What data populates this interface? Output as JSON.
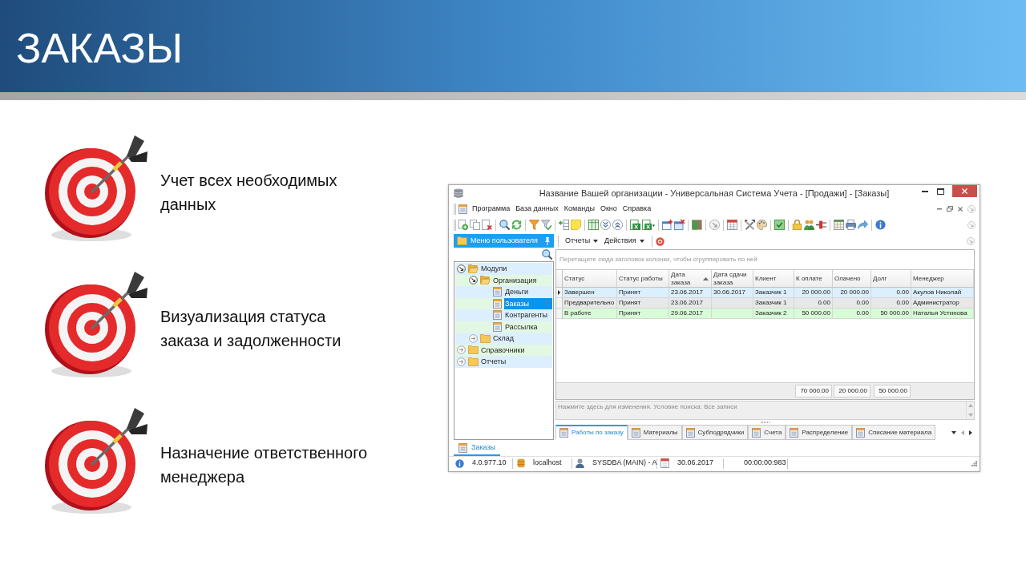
{
  "slide": {
    "title": "ЗАКАЗЫ"
  },
  "features": [
    {
      "text": "Учет всех необходимых\nданных"
    },
    {
      "text": "Визуализация статуса\nзаказа и задолженности"
    },
    {
      "text": "Назначение ответственного\nменеджера"
    }
  ],
  "window": {
    "title": "Название Вашей организации - Универсальная Система Учета - [Продажи] - [Заказы]"
  },
  "menu": [
    "Программа",
    "База данных",
    "Команды",
    "Окно",
    "Справка"
  ],
  "side_panel": {
    "title": "Меню пользователя",
    "tree": [
      {
        "label": "Модули",
        "kind": "folder",
        "expanded": true,
        "selected": false,
        "children": [
          {
            "label": "Организация",
            "kind": "folder",
            "expanded": true,
            "selected": false,
            "children": [
              {
                "label": "Деньги",
                "kind": "form",
                "selected": false
              },
              {
                "label": "Заказы",
                "kind": "form",
                "selected": true
              },
              {
                "label": "Контрагенты",
                "kind": "form",
                "selected": false
              },
              {
                "label": "Рассылка",
                "kind": "form",
                "selected": false
              }
            ]
          },
          {
            "label": "Склад",
            "kind": "folder",
            "expanded": false,
            "selected": false
          }
        ]
      },
      {
        "label": "Справочники",
        "kind": "folder",
        "expanded": false,
        "selected": false
      },
      {
        "label": "Отчеты",
        "kind": "folder",
        "expanded": false,
        "selected": false
      }
    ]
  },
  "panel_toolbar": [
    {
      "label": "Отчеты"
    },
    {
      "label": "Действия"
    }
  ],
  "grid": {
    "group_hint": "Перетащите сюда заголовок колонки, чтобы сгруппировать по ней",
    "columns": [
      {
        "label": "Статус",
        "kind": "text",
        "sorted": false
      },
      {
        "label": "Статус работы",
        "kind": "text",
        "sorted": false
      },
      {
        "label": "Дата\nзаказа",
        "kind": "text",
        "sorted": true
      },
      {
        "label": "Дата сдачи\nзаказа",
        "kind": "text",
        "sorted": false
      },
      {
        "label": "Клиент",
        "kind": "text",
        "sorted": false
      },
      {
        "label": "К оплате",
        "kind": "number",
        "sorted": false,
        "total": "70 000.00"
      },
      {
        "label": "Олачено",
        "kind": "number",
        "sorted": false,
        "total": "20 000.00"
      },
      {
        "label": "Долг",
        "kind": "number",
        "sorted": false,
        "total": "50 000.00"
      },
      {
        "label": "Менеджер",
        "kind": "text",
        "sorted": false
      }
    ],
    "rows": [
      {
        "selected": true,
        "color": "#dbeffd",
        "cells": [
          "Завершен",
          "Принят",
          "23.06.2017",
          "30.06.2017",
          "Заказчик 1",
          "20 000.00",
          "20 000.00",
          "0.00",
          "Акулов Николай"
        ]
      },
      {
        "selected": false,
        "color": "#e8e8e8",
        "cells": [
          "Предварительно",
          "Принят",
          "23.06.2017",
          null,
          "Заказчик 1",
          "0.00",
          "0.00",
          "0.00",
          "Администратор"
        ]
      },
      {
        "selected": false,
        "color": "#d8fbd8",
        "cells": [
          "В работе",
          "Принят",
          "29.06.2017",
          null,
          "Заказчик 2",
          "50 000.00",
          "0.00",
          "50 000.00",
          "Наталья Устинова"
        ]
      }
    ]
  },
  "filter_bar": {
    "text": "Нажмите здесь для изменения. Условие поиска: Все записи"
  },
  "detail_tabs": [
    {
      "label": "Работы по заказу",
      "selected": true
    },
    {
      "label": "Материалы",
      "selected": false
    },
    {
      "label": "Субподрядчики",
      "selected": false
    },
    {
      "label": "Счета",
      "selected": false
    },
    {
      "label": "Распределение",
      "selected": false
    },
    {
      "label": "Списание материала",
      "selected": false
    }
  ],
  "document_tabs": [
    {
      "label": "Заказы",
      "selected": true
    }
  ],
  "status_bar": [
    {
      "kind": "info",
      "text": "4.0.977.10"
    },
    {
      "kind": "database",
      "text": "localhost"
    },
    {
      "kind": "user",
      "text": "SYSDBA (MAIN) - A"
    },
    {
      "kind": "calendar",
      "text": "30.06.2017"
    },
    {
      "kind": "timer",
      "text": "00:00:00:983"
    }
  ]
}
